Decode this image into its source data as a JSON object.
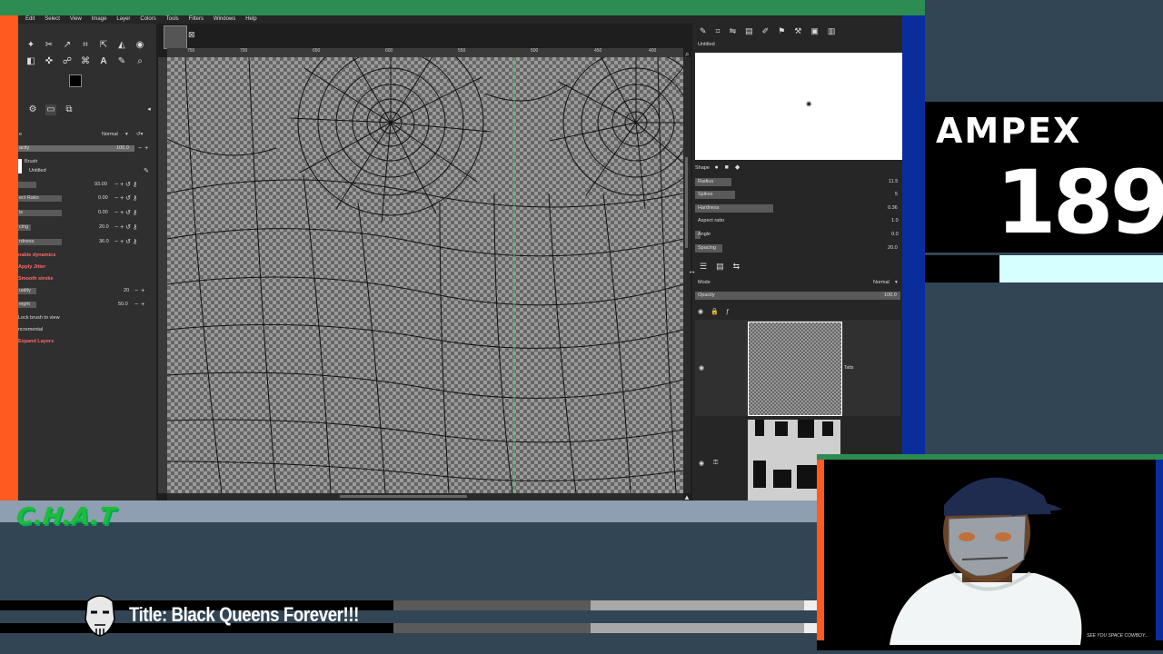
{
  "gimp": {
    "menu": [
      "Edit",
      "Select",
      "View",
      "Image",
      "Layer",
      "Colors",
      "Tools",
      "Filters",
      "Windows",
      "Help"
    ],
    "tool_options": {
      "mode_label": "e",
      "mode_value": "Normal",
      "opacity_label": "acity",
      "opacity_value": "100.0",
      "brush_label": "Brush",
      "brush_name": "Untitled",
      "rows": [
        {
          "label": "",
          "value": "93.00"
        },
        {
          "label": "ect Ratio",
          "value": "0.00"
        },
        {
          "label": "le",
          "value": "0.00"
        },
        {
          "label": "cing",
          "value": "20.0"
        },
        {
          "label": "rdness",
          "value": "36.0"
        }
      ],
      "dynamics": "nable dynamics",
      "jitter": "Apply Jitter",
      "smooth": "Smooth stroke",
      "quality_label": "uality",
      "quality_value": "20",
      "weight_label": "eight",
      "weight_value": "50.0",
      "lock_brush": "Lock brush to view",
      "incremental": "ncremental",
      "expand": "Expand Layers"
    },
    "ruler_labels": [
      "750",
      "700",
      "650",
      "600",
      "550",
      "500",
      "450",
      "400"
    ],
    "brush_editor": {
      "title": "Untitled",
      "shape_label": "Shape",
      "params": [
        {
          "label": "Radius",
          "value": "11.5"
        },
        {
          "label": "Spikes",
          "value": "5"
        },
        {
          "label": "Hardness",
          "value": "0.36"
        },
        {
          "label": "Aspect ratio",
          "value": "1.0"
        },
        {
          "label": "Angle",
          "value": "0.0"
        },
        {
          "label": "Spacing",
          "value": "20.0"
        }
      ]
    },
    "layers": {
      "mode_label": "Mode",
      "mode_value": "Normal",
      "opacity_label": "Opacity",
      "opacity_value": "100.0",
      "layer1_name": "Tatts"
    }
  },
  "overlay": {
    "chat_label": "C.H.A.T",
    "title": "Title: Black Queens Forever!!!",
    "ampex_brand": "AMPEX",
    "ampex_number": "189",
    "cam_caption": "SEE YOU SPACE COWBOY..."
  },
  "colors": {
    "accent_green": "#2d8c52",
    "accent_orange": "#ff5a1f",
    "accent_blue": "#0a2d9e",
    "panel_slate": "#324554"
  }
}
